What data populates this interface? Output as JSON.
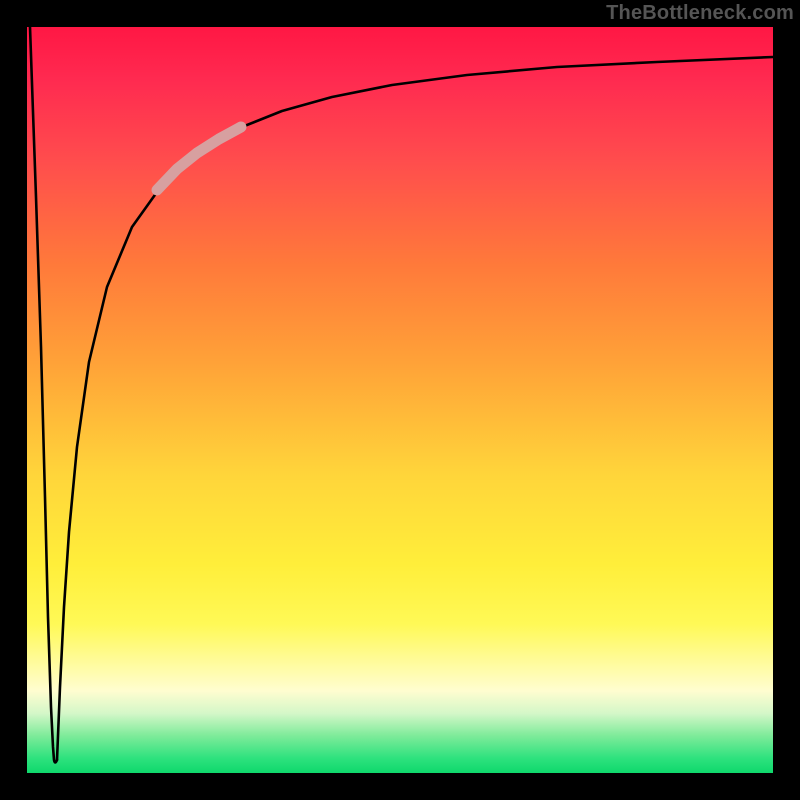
{
  "watermark": "TheBottleneck.com",
  "colors": {
    "frame": "#000000",
    "curve": "#000000",
    "highlight": "#d7a0a0",
    "gradient_stops": [
      "#ff1744",
      "#ff2a50",
      "#ff4d4d",
      "#ff7a3a",
      "#ffa238",
      "#ffd53a",
      "#ffee3a",
      "#fff956",
      "#fffdd0",
      "#d4f7c8",
      "#7eeb9a",
      "#2ee27e",
      "#0fd86c"
    ]
  },
  "chart_data": {
    "type": "line",
    "title": "",
    "xlabel": "",
    "ylabel": "",
    "xlim": [
      0,
      100
    ],
    "ylim": [
      0,
      100
    ],
    "x": [
      0.5,
      1,
      1.5,
      2,
      2.5,
      3,
      3.5,
      4,
      4.5,
      5,
      7,
      10,
      14,
      18,
      22,
      28,
      35,
      45,
      60,
      80,
      100
    ],
    "series": [
      {
        "name": "left-branch",
        "x": [
          0.5,
          1,
          1.5,
          2,
          2.5,
          3,
          3.4
        ],
        "values": [
          100,
          80,
          60,
          40,
          22,
          8,
          2
        ]
      },
      {
        "name": "right-branch",
        "x": [
          3.4,
          4,
          4.5,
          5,
          7,
          10,
          14,
          18,
          22,
          28,
          35,
          45,
          60,
          80,
          100
        ],
        "values": [
          2,
          18,
          30,
          40,
          58,
          70,
          78,
          83,
          86,
          89,
          91,
          93,
          94.5,
          95.5,
          96
        ]
      }
    ],
    "highlight_segment": {
      "series": "right-branch",
      "x_range": [
        18,
        27
      ],
      "y_range": [
        83,
        89
      ]
    },
    "notch": {
      "x": 3.4,
      "y_min": 2
    }
  }
}
